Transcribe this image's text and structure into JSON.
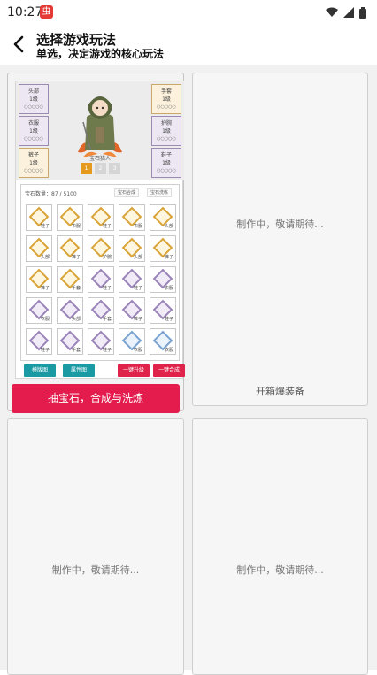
{
  "status": {
    "time": "10:27",
    "app_badge": "虫"
  },
  "header": {
    "title": "选择游戏玩法",
    "subtitle": "单选，决定游戏的核心玩法"
  },
  "cards": [
    {
      "id": "gem",
      "selected": true,
      "preview": {
        "left_slots": [
          {
            "name": "头部",
            "level": "1级",
            "dots": "○○○○○"
          },
          {
            "name": "衣服",
            "level": "1级",
            "dots": "○○○○○"
          },
          {
            "name": "裤子",
            "level": "1级",
            "dots": "○○○○○"
          }
        ],
        "right_slots": [
          {
            "name": "手套",
            "level": "1级",
            "dots": "○○○○○"
          },
          {
            "name": "护腕",
            "level": "1级",
            "dots": "○○○○○"
          },
          {
            "name": "鞋子",
            "level": "1级",
            "dots": "○○○○○"
          }
        ],
        "character_name": "宝石猎人",
        "level_pills": [
          "1",
          "2",
          "3"
        ],
        "inventory": {
          "count_label": "宝石数量：87 / 5100",
          "btn_a": "宝石合成",
          "btn_b": "宝石洗练",
          "gems": [
            {
              "color": "gold",
              "label": "鞋子"
            },
            {
              "color": "gold",
              "label": "衣服"
            },
            {
              "color": "gold",
              "label": "鞋子"
            },
            {
              "color": "gold",
              "label": "衣服"
            },
            {
              "color": "gold",
              "label": "头部"
            },
            {
              "color": "gold",
              "label": "头部"
            },
            {
              "color": "gold",
              "label": "裤子"
            },
            {
              "color": "gold",
              "label": "护腕"
            },
            {
              "color": "gold",
              "label": "头部"
            },
            {
              "color": "gold",
              "label": "裤子"
            },
            {
              "color": "gold",
              "label": "裤子"
            },
            {
              "color": "gold",
              "label": "手套"
            },
            {
              "color": "purple",
              "label": "鞋子"
            },
            {
              "color": "purple",
              "label": "鞋子"
            },
            {
              "color": "purple",
              "label": "衣服"
            },
            {
              "color": "purple",
              "label": "衣服"
            },
            {
              "color": "purple",
              "label": "头部"
            },
            {
              "color": "purple",
              "label": "手套"
            },
            {
              "color": "purple",
              "label": "裤子"
            },
            {
              "color": "purple",
              "label": "鞋子"
            },
            {
              "color": "purple",
              "label": "鞋子"
            },
            {
              "color": "purple",
              "label": "手套"
            },
            {
              "color": "purple",
              "label": "鞋子"
            },
            {
              "color": "blue",
              "label": "衣服"
            },
            {
              "color": "blue",
              "label": "衣服"
            }
          ]
        },
        "buttons": [
          "模版图",
          "属性图",
          "一键升级",
          "一键合成"
        ]
      },
      "action_label": "抽宝石，合成与洗炼"
    },
    {
      "id": "box",
      "placeholder": "制作中，敬请期待...",
      "caption": "开箱爆装备"
    },
    {
      "id": "c3",
      "placeholder": "制作中，敬请期待..."
    },
    {
      "id": "c4",
      "placeholder": "制作中，敬请期待..."
    }
  ],
  "colors": {
    "accent_red": "#e31c4d",
    "teal": "#1a9aa3",
    "gold": "#e59a1f"
  }
}
